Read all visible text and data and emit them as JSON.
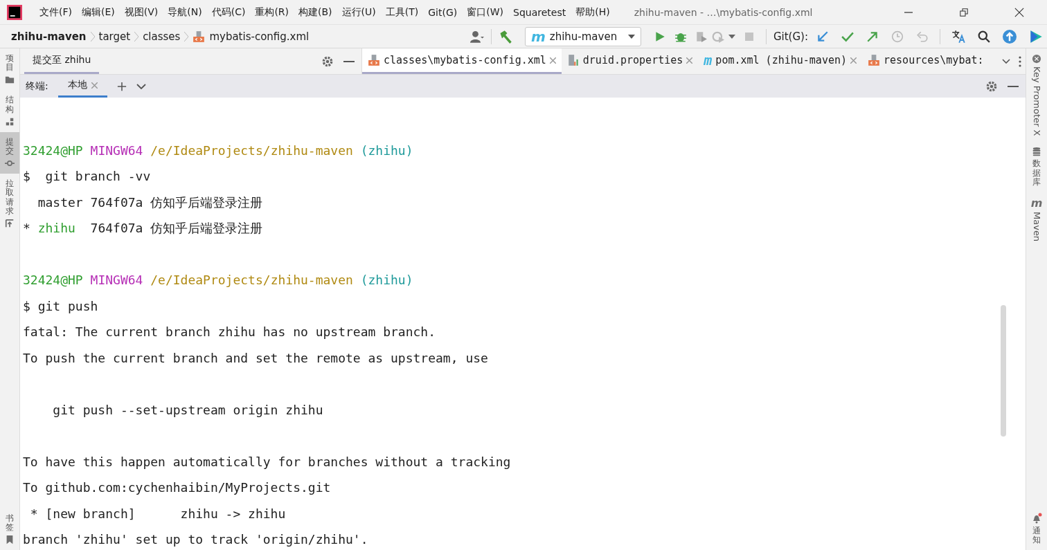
{
  "menu_bar": {
    "items": [
      "文件(F)",
      "编辑(E)",
      "视图(V)",
      "导航(N)",
      "代码(C)",
      "重构(R)",
      "构建(B)",
      "运行(U)",
      "工具(T)",
      "Git(G)",
      "窗口(W)",
      "Squaretest",
      "帮助(H)"
    ],
    "title": "zhihu-maven - …\\mybatis-config.xml"
  },
  "breadcrumb": [
    "zhihu-maven",
    "target",
    "classes",
    "mybatis-config.xml"
  ],
  "toolbar": {
    "run_config_icon": "m",
    "run_config": "zhihu-maven",
    "git_label": "Git(G):"
  },
  "left_sidebar": {
    "top": [
      {
        "label": "项目",
        "kind": "folder",
        "selected": false
      },
      {
        "label": "结构",
        "kind": "structure",
        "selected": false
      },
      {
        "label": "提交",
        "kind": "commit",
        "selected": true
      },
      {
        "label": "拉取请求",
        "kind": "pull",
        "selected": false
      }
    ],
    "bottom": [
      {
        "label": "书签",
        "kind": "bookmark",
        "selected": false
      }
    ]
  },
  "commit_panel": {
    "title": "提交至 zhihu"
  },
  "editor_tabs": [
    {
      "label": "classes\\mybatis-config.xml",
      "kind": "xml",
      "selected": true
    },
    {
      "label": "druid.properties",
      "kind": "properties",
      "selected": false
    },
    {
      "label": "pom.xml (zhihu-maven)",
      "kind": "maven",
      "glyph": "m",
      "selected": false
    },
    {
      "label": "resources\\mybat:",
      "kind": "xml",
      "selected": false
    }
  ],
  "terminal": {
    "label": "终端:",
    "tabs": [
      {
        "label": "本地",
        "selected": true
      }
    ],
    "lines": [
      {
        "kind": "blank"
      },
      {
        "kind": "text",
        "segments": [
          {
            "text": "32424@HP",
            "kind": "user"
          },
          {
            "text": " MINGW64",
            "kind": "host"
          },
          {
            "text": " /e/IdeaProjects/zhihu-maven",
            "kind": "path"
          },
          {
            "text": " (zhihu)",
            "kind": "branch"
          }
        ]
      },
      {
        "kind": "text",
        "segments": [
          {
            "text": "$  git branch -vv"
          }
        ]
      },
      {
        "kind": "text",
        "segments": [
          {
            "text": "  master 764f07a 仿知乎后端登录注册"
          }
        ]
      },
      {
        "kind": "text",
        "segments": [
          {
            "text": "* "
          },
          {
            "text": "zhihu",
            "kind": "current"
          },
          {
            "text": "  764f07a 仿知乎后端登录注册"
          }
        ]
      },
      {
        "kind": "blank"
      },
      {
        "kind": "text",
        "segments": [
          {
            "text": "32424@HP",
            "kind": "user"
          },
          {
            "text": " MINGW64",
            "kind": "host"
          },
          {
            "text": " /e/IdeaProjects/zhihu-maven",
            "kind": "path"
          },
          {
            "text": " (zhihu)",
            "kind": "branch"
          }
        ]
      },
      {
        "kind": "text",
        "segments": [
          {
            "text": "$ git push"
          }
        ]
      },
      {
        "kind": "text",
        "segments": [
          {
            "text": "fatal: The current branch zhihu has no upstream branch."
          }
        ]
      },
      {
        "kind": "text",
        "segments": [
          {
            "text": "To push the current branch and set the remote as upstream, use"
          }
        ]
      },
      {
        "kind": "blank"
      },
      {
        "kind": "text",
        "segments": [
          {
            "text": "    git push --set-upstream origin zhihu"
          }
        ]
      },
      {
        "kind": "blank"
      },
      {
        "kind": "text",
        "segments": [
          {
            "text": "To have this happen automatically for branches without a tracking"
          }
        ]
      },
      {
        "kind": "text",
        "segments": [
          {
            "text": "To github.com:cychenhaibin/MyProjects.git"
          }
        ]
      },
      {
        "kind": "text",
        "segments": [
          {
            "text": " * [new branch]      zhihu -> zhihu"
          }
        ]
      },
      {
        "kind": "text",
        "segments": [
          {
            "text": "branch 'zhihu' set up to track 'origin/zhihu'."
          }
        ]
      }
    ]
  },
  "right_sidebar": {
    "top": [
      {
        "label": "Key Promoter X",
        "kind": "key"
      },
      {
        "label": "数据库",
        "kind": "database"
      },
      {
        "label": "Maven",
        "kind": "maven",
        "glyph": "m"
      }
    ],
    "bottom": [
      {
        "label": "通知",
        "kind": "bell"
      }
    ]
  }
}
